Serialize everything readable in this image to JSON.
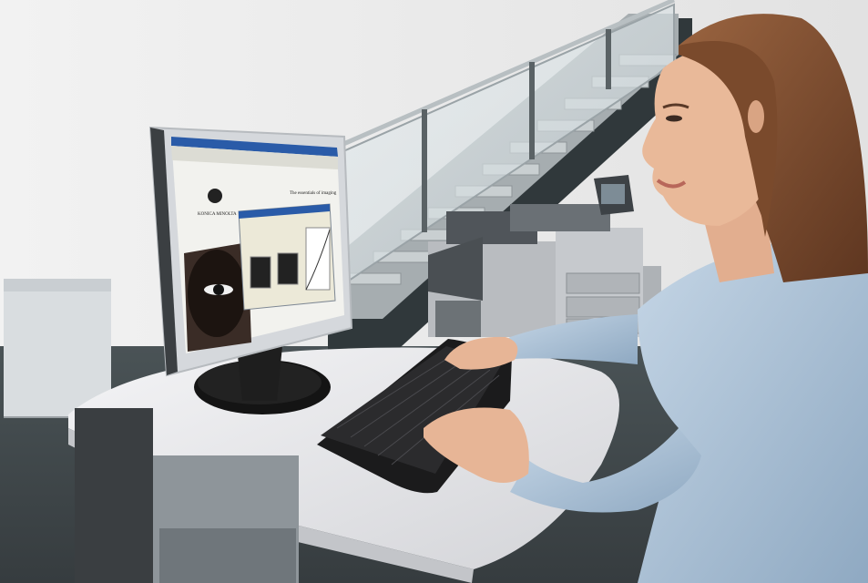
{
  "photo": {
    "subject": "woman-at-workstation",
    "monitor_screen": {
      "brand_text": "KONICA MINOLTA",
      "tagline": "The essentials of imaging"
    }
  },
  "colors": {
    "wall": "#eeeeee",
    "floor": "#3f474a",
    "desk_top": "#e6e6e8",
    "monitor_bezel": "#d5d8dc",
    "screen_bg": "#f2f2ee",
    "titlebar": "#2a5ba8",
    "printer_body": "#b9bcc0",
    "printer_dark": "#50555a",
    "shirt": "#a9bfd3",
    "hair": "#7a4a2c",
    "skin": "#e7b596"
  }
}
